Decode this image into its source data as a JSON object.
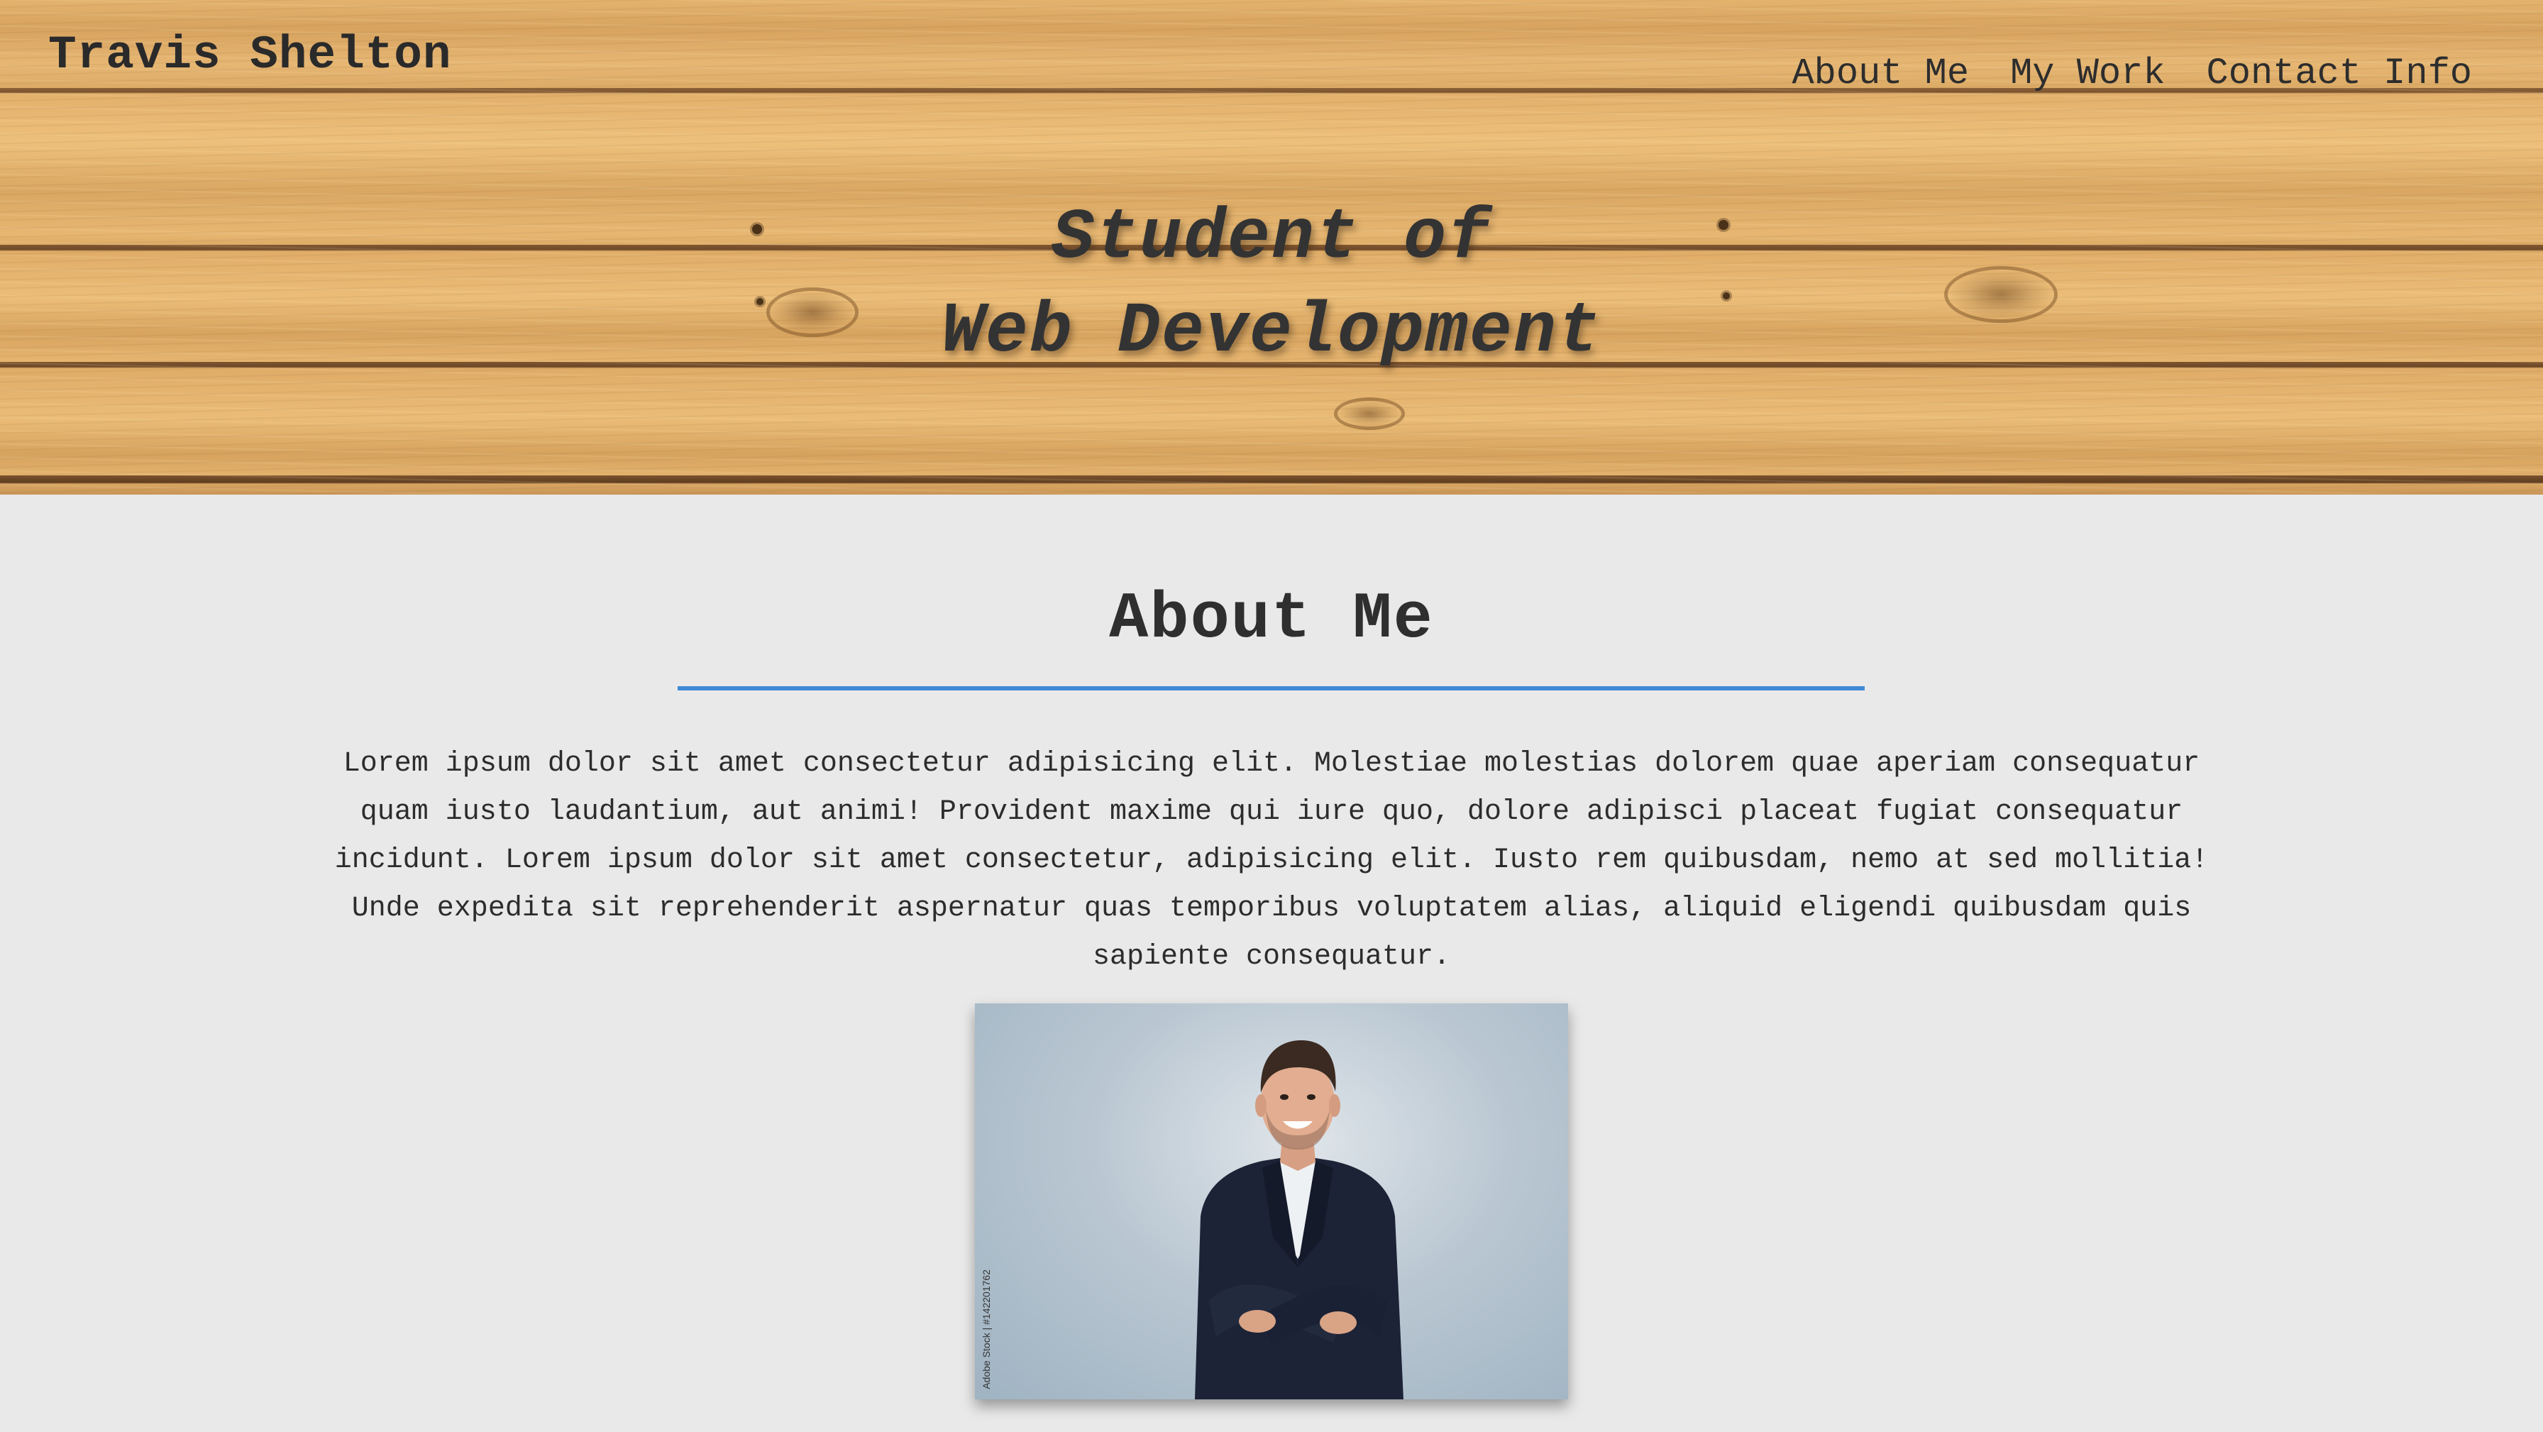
{
  "header": {
    "brand": "Travis Shelton",
    "nav": [
      {
        "label": "About Me"
      },
      {
        "label": "My Work"
      },
      {
        "label": "Contact Info"
      }
    ],
    "tagline_line1": "Student of",
    "tagline_line2": "Web Development"
  },
  "about": {
    "title": "About Me",
    "text": "Lorem ipsum dolor sit amet consectetur adipisicing elit. Molestiae molestias dolorem quae aperiam consequatur quam iusto laudantium, aut animi! Provident maxime qui iure quo, dolore adipisci placeat fugiat consequatur incidunt. Lorem ipsum dolor sit amet consectetur, adipisicing elit. Iusto rem quibusdam, nemo at sed mollitia! Unde expedita sit reprehenderit aspernatur quas temporibus voluptatem alias, aliquid eligendi quibusdam quis sapiente consequatur.",
    "photo_watermark": "Adobe Stock | #142201762"
  },
  "colors": {
    "accent_divider": "#3f8ad6",
    "page_background": "#e9e9e9",
    "text": "#2f2f2f"
  }
}
